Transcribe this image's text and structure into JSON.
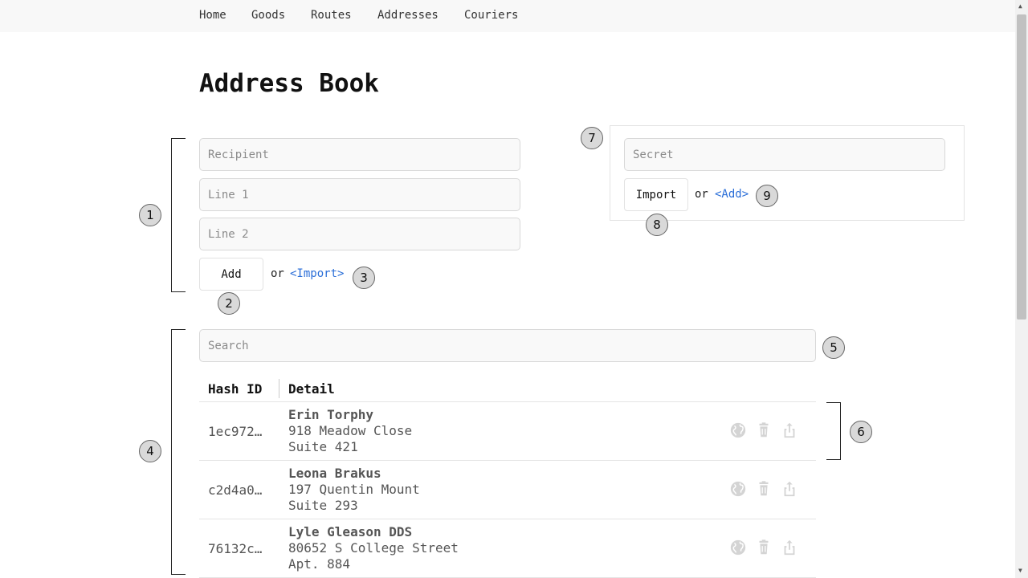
{
  "nav": {
    "items": [
      "Home",
      "Goods",
      "Routes",
      "Addresses",
      "Couriers"
    ]
  },
  "page_title": "Address Book",
  "add_form": {
    "recipient_placeholder": "Recipient",
    "line1_placeholder": "Line 1",
    "line2_placeholder": "Line 2",
    "add_label": "Add",
    "or_text": "or",
    "import_link": "<Import>"
  },
  "import_form": {
    "secret_placeholder": "Secret",
    "import_label": "Import",
    "or_text": "or",
    "add_link": "<Add>"
  },
  "search": {
    "placeholder": "Search"
  },
  "table": {
    "headers": [
      "Hash ID",
      "Detail"
    ],
    "rows": [
      {
        "hash": "1ec972…",
        "name": "Erin Torphy",
        "line1": "918 Meadow Close",
        "line2": "Suite 421"
      },
      {
        "hash": "c2d4a0…",
        "name": "Leona Brakus",
        "line1": "197 Quentin Mount",
        "line2": "Suite 293"
      },
      {
        "hash": "76132c…",
        "name": "Lyle Gleason DDS",
        "line1": "80652 S College Street",
        "line2": "Apt. 884"
      }
    ],
    "row_icons": [
      "globe-icon",
      "trash-icon",
      "share-icon"
    ],
    "icon_color": "#d4d4d4"
  },
  "callouts": [
    "1",
    "2",
    "3",
    "4",
    "5",
    "6",
    "7",
    "8",
    "9"
  ],
  "colors": {
    "link": "#2a6ed8",
    "nav_bg": "#f8f8f8",
    "callout_bg": "#d9d9d9"
  }
}
